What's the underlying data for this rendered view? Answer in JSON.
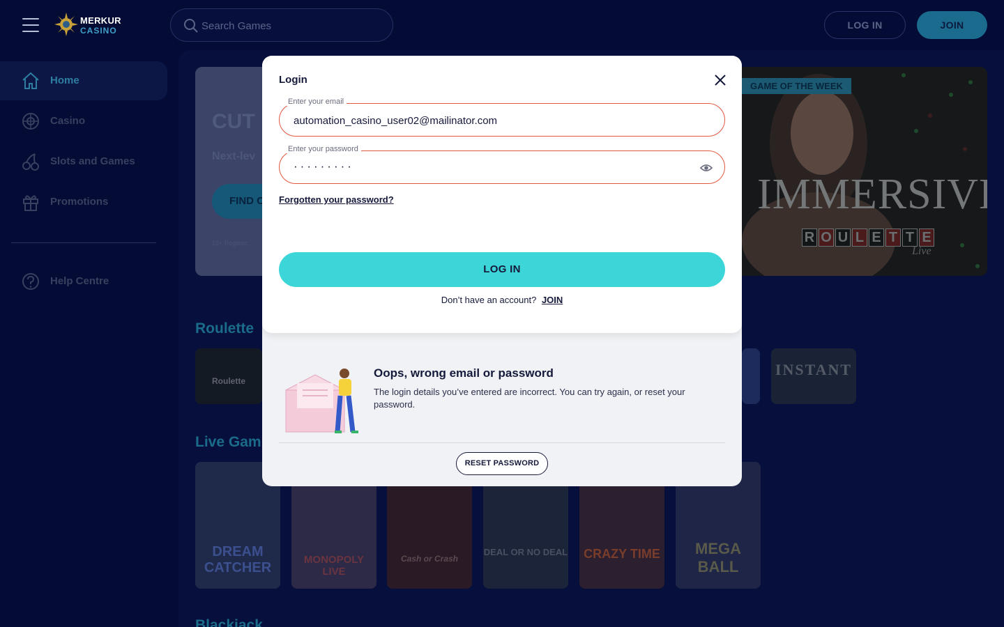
{
  "header": {
    "logo_line1": "MERKUR",
    "logo_line2": "CASINO",
    "search_placeholder": "Search Games",
    "login_label": "LOG IN",
    "join_label": "JOIN"
  },
  "sidebar": {
    "items": [
      {
        "label": "Home",
        "icon": "home-icon",
        "active": true
      },
      {
        "label": "Casino",
        "icon": "roulette-wheel-icon",
        "active": false
      },
      {
        "label": "Slots and Games",
        "icon": "cherries-icon",
        "active": false
      },
      {
        "label": "Promotions",
        "icon": "gift-icon",
        "active": false
      }
    ],
    "help_label": "Help Centre"
  },
  "main": {
    "hero_title": "CUT",
    "hero_subtitle": "Next-lev",
    "hero_button": "FIND C",
    "hero_terms": "18+ Register...",
    "game_of_week_badge": "GAME OF THE WEEK",
    "game_of_week_title": "IMMERSIVE",
    "game_of_week_letters": [
      "R",
      "O",
      "U",
      "L",
      "E",
      "T",
      "T",
      "E"
    ],
    "game_of_week_live": "Live",
    "sections": [
      "Roulette",
      "Live Gam",
      "Blackjack"
    ],
    "roulette_tiles": [
      "Roulette",
      "INSTANT"
    ],
    "live_tiles": [
      "DREAM CATCHER",
      "MONOPOLY LIVE",
      "Cash or Crash",
      "DEAL OR NO DEAL",
      "CRAZY TIME",
      "MEGA BALL"
    ]
  },
  "modal": {
    "title": "Login",
    "email_label": "Enter your email",
    "email_value": "automation_casino_user02@mailinator.com",
    "password_label": "Enter your password",
    "password_mask": "·········",
    "forgot_link": "Forgotten your password?",
    "login_button": "LOG IN",
    "no_account_text": "Don’t have an account?",
    "join_link": "JOIN",
    "error_title": "Oops, wrong email or password",
    "error_text": "The login details you’ve entered are incorrect. You can try again, or reset your password.",
    "reset_button": "RESET PASSWORD"
  },
  "colors": {
    "page_bg": "#040b35",
    "accent_teal": "#3dd6d8",
    "error_border": "#e0573f",
    "join_button": "#1b6b8e"
  }
}
